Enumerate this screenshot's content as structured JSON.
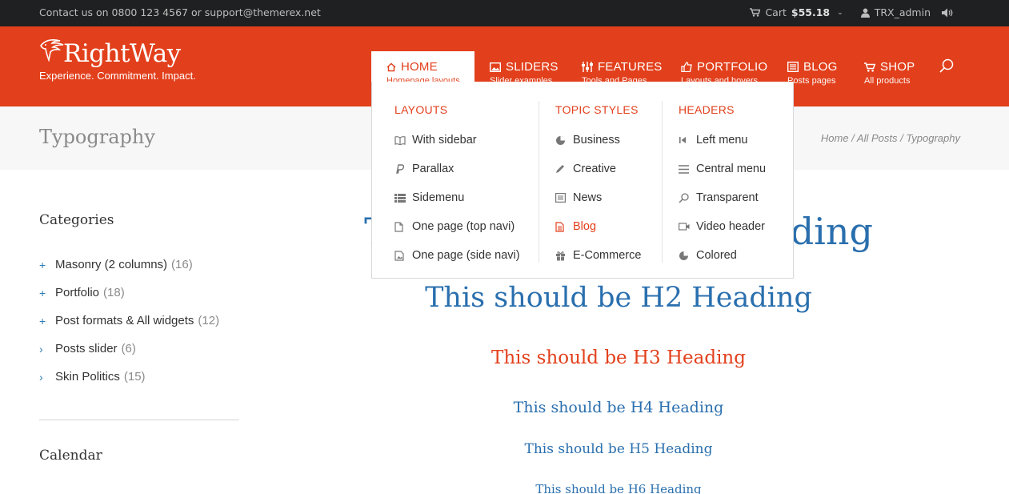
{
  "topbar": {
    "contact": "Contact us on 0800 123 4567 or support@themerex.net",
    "cart_label": "Cart",
    "cart_amount": "$55.18",
    "user": "TRX_admin"
  },
  "logo": {
    "name": "RightWay",
    "tagline": "Experience. Commitment. Impact."
  },
  "nav": {
    "items": [
      {
        "label": "HOME",
        "sub": "Homepage layouts",
        "icon": "home-icon"
      },
      {
        "label": "SLIDERS",
        "sub": "Slider examples",
        "icon": "image-icon"
      },
      {
        "label": "FEATURES",
        "sub": "Tools and Pages",
        "icon": "sliders-icon"
      },
      {
        "label": "PORTFOLIO",
        "sub": "Layouts and hovers",
        "icon": "thumbs-up-icon"
      },
      {
        "label": "BLOG",
        "sub": "Posts pages",
        "icon": "newspaper-icon"
      },
      {
        "label": "SHOP",
        "sub": "All products",
        "icon": "cart-icon"
      }
    ]
  },
  "dropdown": {
    "layouts": {
      "title": "LAYOUTS",
      "items": [
        "With sidebar",
        "Parallax",
        "Sidemenu",
        "One page (top navi)",
        "One page (side navi)"
      ]
    },
    "topics": {
      "title": "TOPIC STYLES",
      "items": [
        "Business",
        "Creative",
        "News",
        "Blog",
        "E-Commerce"
      ]
    },
    "headers": {
      "title": "HEADERS",
      "items": [
        "Left menu",
        "Central menu",
        "Transparent",
        "Video header",
        "Colored"
      ]
    }
  },
  "page": {
    "title": "Typography",
    "breadcrumb": "Home / All Posts / Typography"
  },
  "sidebar": {
    "categories_title": "Categories",
    "categories": [
      {
        "name": "Masonry (2 columns)",
        "count": "(16)",
        "mark": "+"
      },
      {
        "name": "Portfolio",
        "count": "(18)",
        "mark": "+"
      },
      {
        "name": "Post formats & All widgets",
        "count": "(12)",
        "mark": "+"
      },
      {
        "name": "Posts slider",
        "count": "(6)",
        "mark": "›"
      },
      {
        "name": "Skin Politics",
        "count": "(15)",
        "mark": "›"
      }
    ],
    "calendar_title": "Calendar"
  },
  "headings": {
    "h1": "This should be H1 Heading",
    "h2": "This should be H2 Heading",
    "h3": "This should be H3 Heading",
    "h4": "This should be H4 Heading",
    "h5": "This should be H5 Heading",
    "h6": "This should be H6 Heading"
  },
  "colors": {
    "accent": "#e2401c",
    "link_blue": "#2a6fae",
    "topbar_bg": "#1f2021"
  }
}
